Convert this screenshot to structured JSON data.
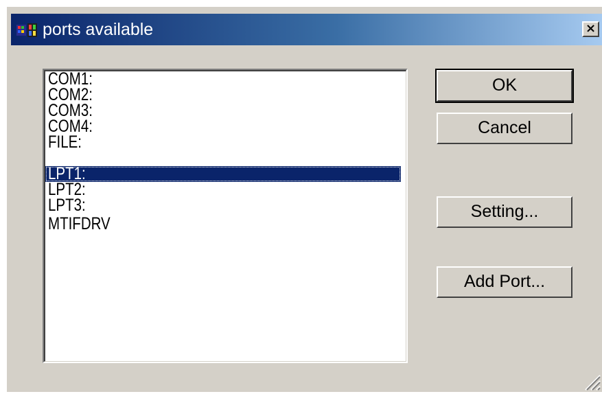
{
  "window": {
    "title": "ports available",
    "close_label": "×"
  },
  "ports": {
    "items": [
      "COM1:",
      "COM2:",
      "COM3:",
      "COM4:",
      "FILE:",
      "LPT1:",
      "LPT2:",
      "LPT3:",
      "MTIFDRV"
    ],
    "selected": "LPT1:"
  },
  "buttons": {
    "ok": "OK",
    "cancel": "Cancel",
    "setting": "Setting...",
    "add_port": "Add Port..."
  },
  "colors": {
    "title_start": "#0a246a",
    "title_end": "#a6caf0",
    "face": "#d4d0c8",
    "selection": "#0a246a"
  },
  "icons": {
    "app": "printer-app-icon",
    "close": "close-icon",
    "grip": "resize-grip-icon"
  }
}
